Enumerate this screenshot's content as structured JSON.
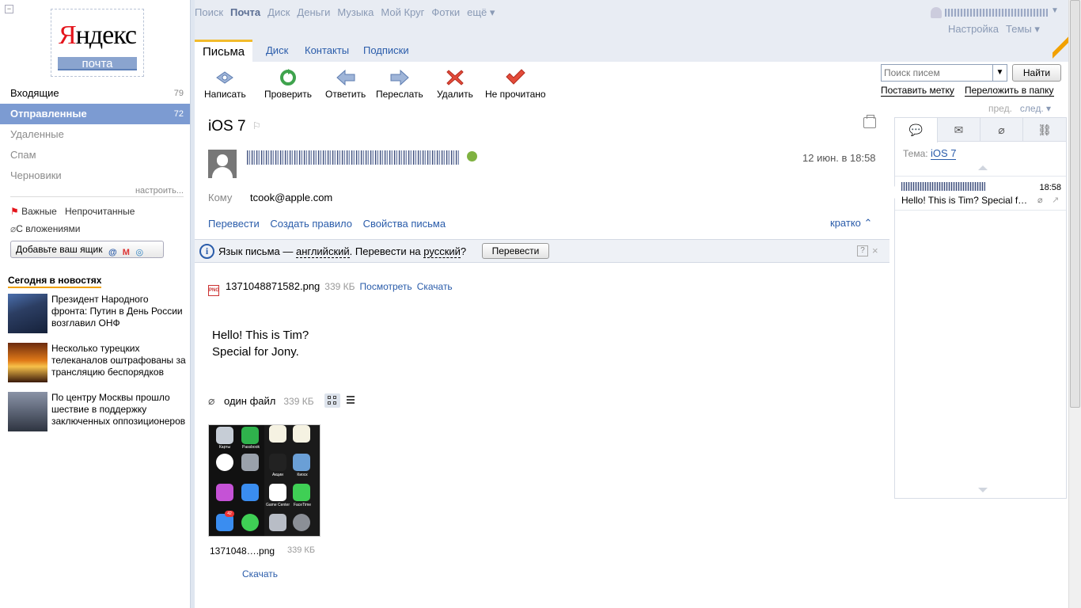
{
  "logo": {
    "word_ya": "Я",
    "word_rest": "ндекс",
    "sub": "почта"
  },
  "folders": [
    {
      "label": "Входящие",
      "count": "79"
    },
    {
      "label": "Отправленные",
      "count": "72"
    },
    {
      "label": "Удаленные",
      "count": ""
    },
    {
      "label": "Спам",
      "count": ""
    },
    {
      "label": "Черновики",
      "count": ""
    }
  ],
  "folders_settings": "настроить...",
  "labels": {
    "important": "Важные",
    "unread": "Непрочитанные",
    "attachments": "С вложениями"
  },
  "add_mailbox": "Добавьте ваш ящик",
  "news": {
    "heading": "Сегодня в новостях",
    "items": [
      {
        "text": "Президент Народного фронта: Путин в День России возглавил ОНФ"
      },
      {
        "text": "Несколько турецких телеканалов оштрафованы за трансляцию беспорядков"
      },
      {
        "text": "По центру Москвы прошло шествие в поддержку заключенных оппозиционеров"
      }
    ]
  },
  "topnav": [
    "Поиск",
    "Почта",
    "Диск",
    "Деньги",
    "Музыка",
    "Мой Круг",
    "Фотки",
    "ещё ▾"
  ],
  "header": {
    "settings": "Настройка",
    "themes": "Темы ▾"
  },
  "tabs": [
    "Письма",
    "Диск",
    "Контакты",
    "Подписки"
  ],
  "toolbar": {
    "compose": "Написать",
    "check": "Проверить",
    "reply": "Ответить",
    "forward": "Переслать",
    "delete": "Удалить",
    "unread": "Не прочитано"
  },
  "search": {
    "placeholder": "Поиск писем",
    "button": "Найти",
    "mark": "Поставить метку",
    "move": "Переложить в папку"
  },
  "message": {
    "subject": "iOS 7",
    "date": "12 июн. в 18:58",
    "to_label": "Кому",
    "to_value": "tcook@apple.com",
    "actions": [
      "Перевести",
      "Создать правило",
      "Свойства письма"
    ],
    "brief": "кратко",
    "translate": {
      "prefix": "Язык письма — ",
      "lang": "английский",
      "mid": ". Перевести на ",
      "target": "русский",
      "suffix": "?",
      "button": "Перевести",
      "help": "?"
    },
    "attachment": {
      "name": "1371048871582.png",
      "size": "339 КБ",
      "view": "Посмотреть",
      "download": "Скачать",
      "type": "PNG"
    },
    "body_lines": [
      "Hello! This is Tim?",
      "Special for Jony."
    ],
    "files": {
      "label": "один файл",
      "size": "339 КБ"
    },
    "thumb": {
      "name": "1371048….png",
      "size": "339 КБ",
      "download": "Скачать",
      "labels": [
        "Карты",
        "Passbook",
        "Акции",
        "Киоск",
        "Game Center",
        "FaceTime"
      ],
      "badge": "42"
    }
  },
  "thread": {
    "pager_prev": "пред.",
    "pager_next": "след. ▾",
    "topic_label": "Тема:",
    "topic": "iOS 7",
    "item_time": "18:58",
    "item_snippet": "Hello! This is Tim? Special for Jony."
  },
  "colors": {
    "active_folder": "#7c9bd2",
    "accent_tab": "#f2bb2c",
    "link": "#2a5caa",
    "logo_red": "#e4141b"
  }
}
